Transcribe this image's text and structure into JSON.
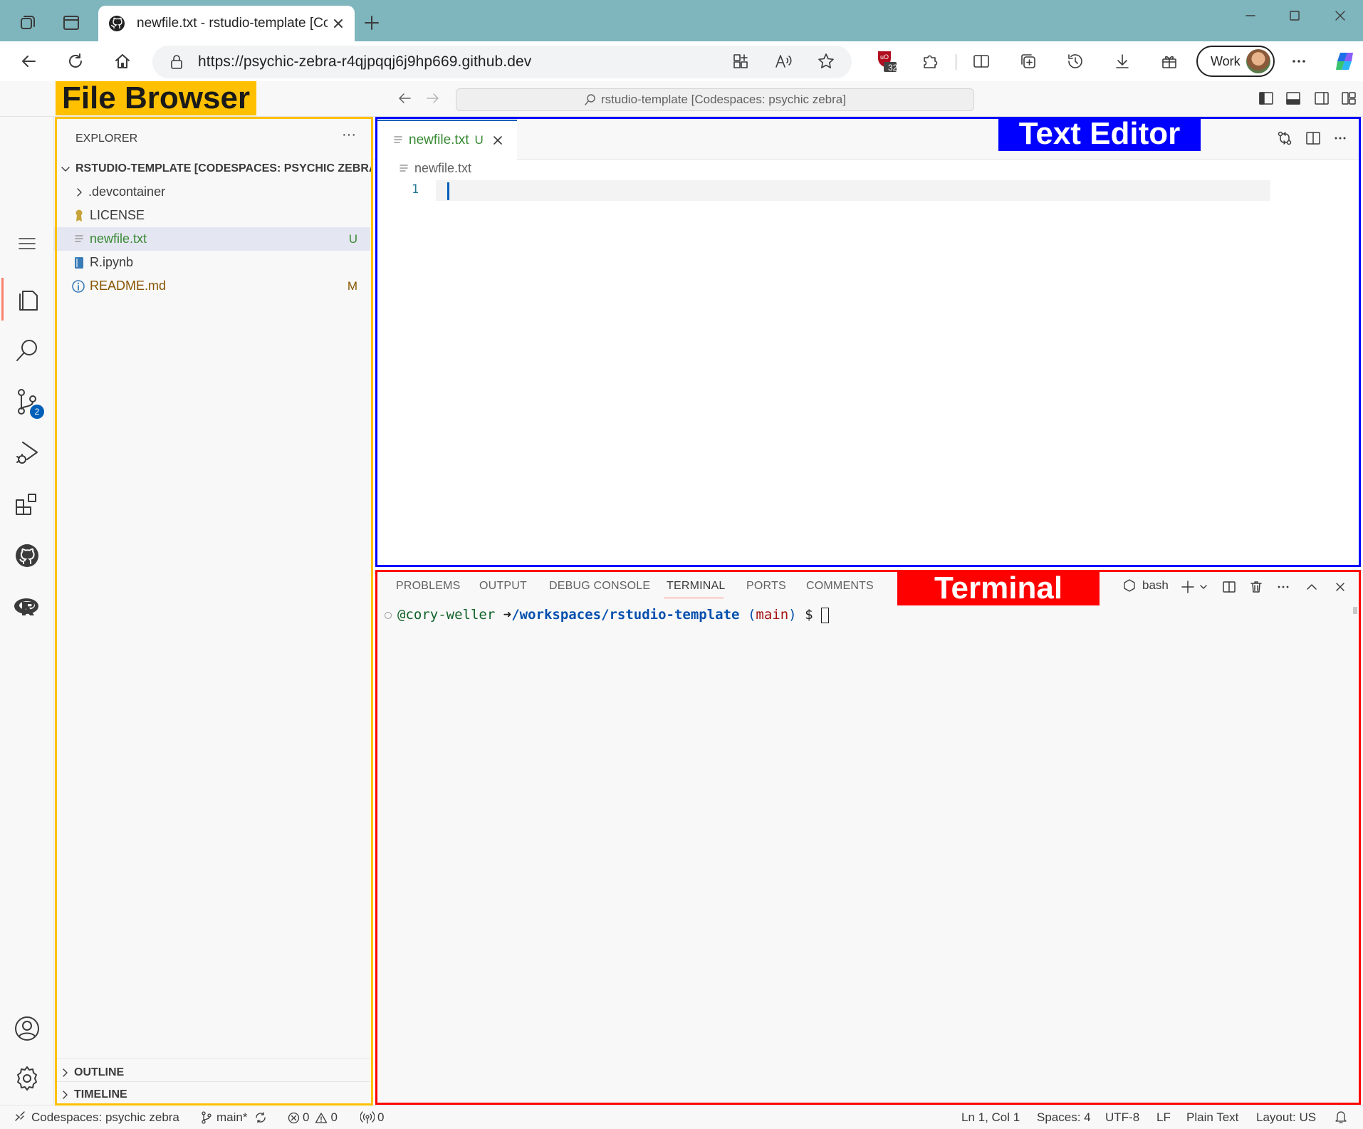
{
  "browser": {
    "tab_title": "newfile.txt - rstudio-template [Codespaces: psychic zebra]",
    "url": "https://psychic-zebra-r4qjpqqj6j9hp669.github.dev",
    "extension_badge": "32",
    "profile_label": "Work"
  },
  "vscode": {
    "command_center": "rstudio-template [Codespaces: psychic zebra]",
    "scm_badge": "2"
  },
  "explorer": {
    "title": "EXPLORER",
    "more": "···",
    "root": "RSTUDIO-TEMPLATE [CODESPACES: PSYCHIC ZEBRA]",
    "items": [
      {
        "label": ".devcontainer",
        "badge": ""
      },
      {
        "label": "LICENSE",
        "badge": ""
      },
      {
        "label": "newfile.txt",
        "badge": "U"
      },
      {
        "label": "R.ipynb",
        "badge": ""
      },
      {
        "label": "README.md",
        "badge": "M"
      }
    ],
    "outline": "OUTLINE",
    "timeline": "TIMELINE"
  },
  "editor": {
    "tab_label": "newfile.txt",
    "tab_badge": "U",
    "breadcrumb": "newfile.txt",
    "line_number": "1"
  },
  "panel": {
    "tabs": [
      "PROBLEMS",
      "OUTPUT",
      "DEBUG CONSOLE",
      "TERMINAL",
      "PORTS",
      "COMMENTS"
    ],
    "active_tab": "TERMINAL",
    "shell": "bash",
    "terminal": {
      "user": "@cory-weller",
      "arrow": "➜",
      "path": "/workspaces/rstudio-template",
      "open_paren": "(",
      "branch": "main",
      "close_paren": ")",
      "prompt": "$"
    }
  },
  "status_bar": {
    "remote": "Codespaces: psychic zebra",
    "branch": "main*",
    "errors": "0",
    "warnings": "0",
    "ports": "0",
    "position": "Ln 1, Col 1",
    "spaces": "Spaces: 4",
    "encoding": "UTF-8",
    "eol": "LF",
    "language": "Plain Text",
    "layout": "Layout: US"
  },
  "annotations": {
    "file_browser": "File Browser",
    "text_editor": "Text Editor",
    "terminal": "Terminal"
  },
  "colors": {
    "file_browser_outline": "#ffc000",
    "text_editor_outline": "#0000ff",
    "terminal_outline": "#ff0000",
    "untracked": "#388a34",
    "modified": "#895503",
    "accent": "#005fb8"
  }
}
